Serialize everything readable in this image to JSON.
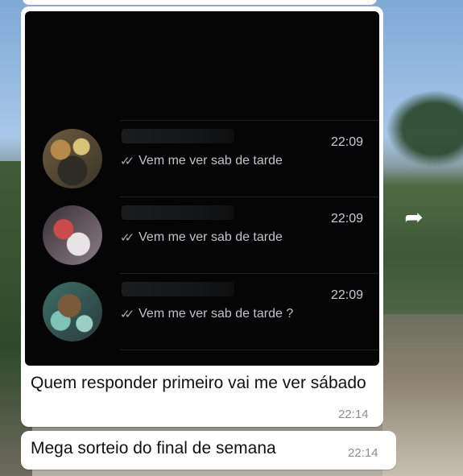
{
  "forwarded_screenshot": {
    "rows": [
      {
        "time": "22:09",
        "preview": "Vem me ver sab de tarde",
        "status_icon": "double-check-icon",
        "status_glyph": "✓✓"
      },
      {
        "time": "22:09",
        "preview": "Vem me ver sab de tarde",
        "status_icon": "double-check-icon",
        "status_glyph": "✓✓"
      },
      {
        "time": "22:09",
        "preview": "Vem me ver sab de tarde ?",
        "status_icon": "double-check-icon",
        "status_glyph": "✓✓"
      }
    ]
  },
  "messages": [
    {
      "text": "Quem responder primeiro vai me ver sábado",
      "time": "22:14"
    },
    {
      "text": "Mega sorteio do final de semana",
      "time": "22:14"
    }
  ],
  "share_icon": "share-arrow-icon",
  "colors": {
    "bubble": "#ffffff",
    "screenshot_bg": "#050506",
    "timestamp": "#8d8d8d"
  }
}
